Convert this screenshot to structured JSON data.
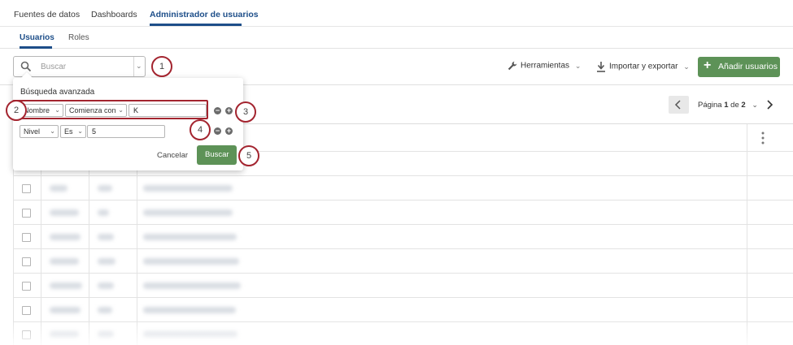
{
  "top_tabs": [
    "Fuentes de datos",
    "Dashboards",
    "Administrador de usuarios"
  ],
  "sub_tabs": [
    "Usuarios",
    "Roles"
  ],
  "search": {
    "placeholder": "Buscar"
  },
  "toolbar": {
    "tools_label": "Herramientas",
    "import_export_label": "Importar y exportar",
    "add_users_label": "Añadir usuarios"
  },
  "pagination": {
    "label_prefix": "Página ",
    "current": "1",
    "label_mid": " de ",
    "total": "2"
  },
  "advanced_search": {
    "title": "Búsqueda avanzada",
    "row1": {
      "field": "Nombre",
      "operator": "Comienza con",
      "value": "K"
    },
    "row2": {
      "field": "Nivel",
      "operator": "Es",
      "value": "5"
    },
    "cancel_label": "Cancelar",
    "search_label": "Buscar"
  },
  "callouts": [
    "1",
    "2",
    "3",
    "4",
    "5"
  ],
  "colors": {
    "accent_blue": "#1d4e89",
    "green": "#5d9257",
    "callout_red": "#a3242f"
  }
}
